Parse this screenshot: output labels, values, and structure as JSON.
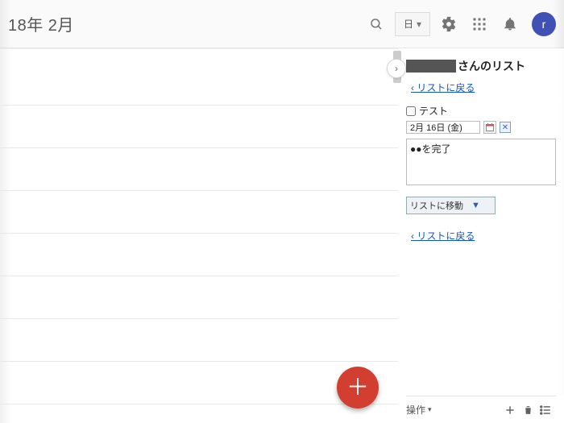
{
  "header": {
    "date_title": "18年 2月",
    "view_label": "日",
    "avatar_initial": "r"
  },
  "panel": {
    "list_title_suffix": "さんのリスト",
    "back_to_list": "‹ リストに戻る",
    "task_title": "テスト",
    "date_value": "2月 16日 (金)",
    "note_value": "●●を完了",
    "move_label": "リストに移動",
    "back_to_list2": "‹ リストに戻る",
    "actions_label": "操作"
  },
  "fab": {
    "glyph": "＋"
  }
}
